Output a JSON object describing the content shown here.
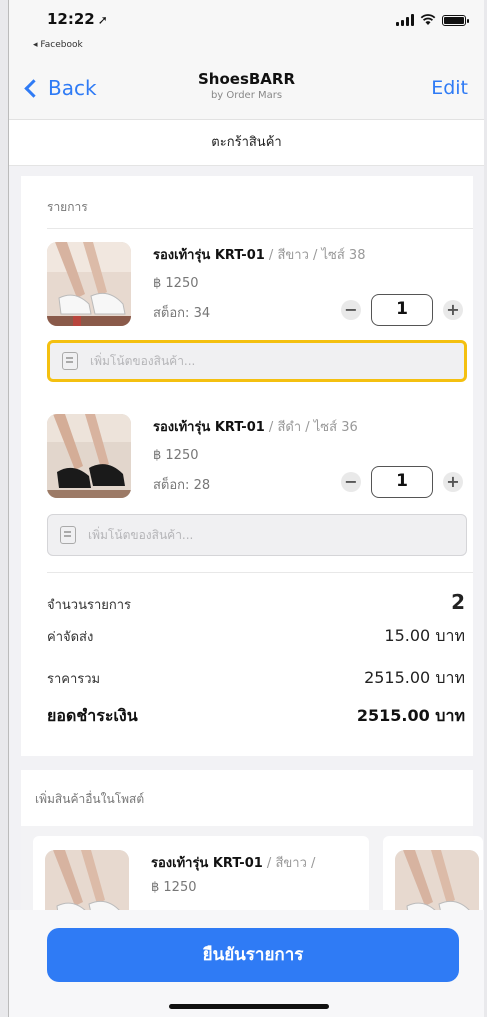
{
  "status": {
    "time": "12:22",
    "back_app": "◂ Facebook"
  },
  "nav": {
    "back_label": "Back",
    "title": "ShoesBARR",
    "subtitle": "by Order Mars",
    "edit_label": "Edit"
  },
  "page_header": "ตะกร้าสินค้า",
  "items_section_label": "รายการ",
  "items": [
    {
      "name": "รองเท้ารุ่น KRT-01",
      "variant": " / สีขาว / ไซส์ 38",
      "price": "฿ 1250",
      "stock": "สต็อก: 34",
      "qty": "1",
      "note_placeholder": "เพิ่มโน้ตของสินค้า..."
    },
    {
      "name": "รองเท้ารุ่น KRT-01",
      "variant": " / สีดำ / ไซส์ 36",
      "price": "฿ 1250",
      "stock": "สต็อก: 28",
      "qty": "1",
      "note_placeholder": "เพิ่มโน้ตของสินค้า..."
    }
  ],
  "summary": {
    "count_label": "จำนวนรายการ",
    "count_value": "2",
    "shipping_label": "ค่าจัดส่ง",
    "shipping_value": "15.00 บาท",
    "subtotal_label": "ราคารวม",
    "subtotal_value": "2515.00 บาท",
    "total_label": "ยอดชำระเงิน",
    "total_value": "2515.00 บาท"
  },
  "more_section": {
    "label": "เพิ่มสินค้าอื่นในโพสต์",
    "card_name": "รองเท้ารุ่น KRT-01",
    "card_variant": " / สีขาว /",
    "card_price": "฿ 1250"
  },
  "confirm_button": "ยืนยันรายการ",
  "colors": {
    "accent": "#2f7bf5",
    "focus_highlight": "#f4c010"
  }
}
